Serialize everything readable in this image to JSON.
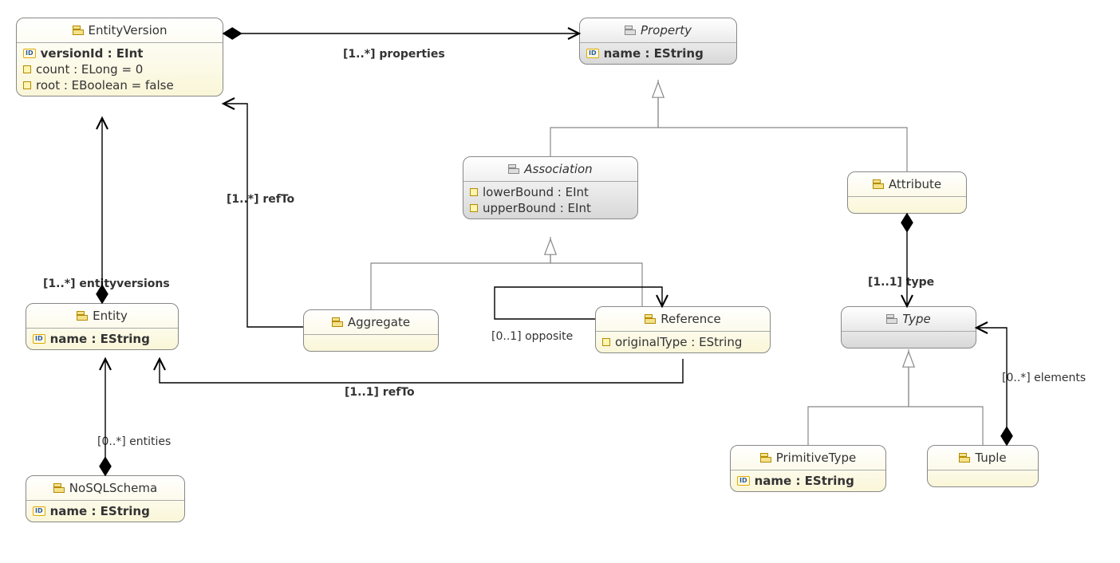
{
  "classes": {
    "EntityVersion": {
      "name": "EntityVersion",
      "attrs": {
        "versionId": "versionId : EInt",
        "count": "count : ELong = 0",
        "root": "root : EBoolean = false"
      }
    },
    "Property": {
      "name": "Property",
      "attrs": {
        "name": "name : EString"
      }
    },
    "Association": {
      "name": "Association",
      "attrs": {
        "lowerBound": "lowerBound : EInt",
        "upperBound": "upperBound : EInt"
      }
    },
    "Attribute": {
      "name": "Attribute",
      "attrs": {}
    },
    "Entity": {
      "name": "Entity",
      "attrs": {
        "name": "name : EString"
      }
    },
    "Aggregate": {
      "name": "Aggregate",
      "attrs": {}
    },
    "Reference": {
      "name": "Reference",
      "attrs": {
        "originalType": "originalType : EString"
      }
    },
    "Type": {
      "name": "Type",
      "attrs": {}
    },
    "PrimitiveType": {
      "name": "PrimitiveType",
      "attrs": {
        "name": "name : EString"
      }
    },
    "Tuple": {
      "name": "Tuple",
      "attrs": {}
    },
    "NoSQLSchema": {
      "name": "NoSQLSchema",
      "attrs": {
        "name": "name : EString"
      }
    }
  },
  "edges": {
    "properties": "[1..*] properties",
    "refToAgg": "[1..*] refTo",
    "entityversions": "[1..*] entityversions",
    "entities": "[0..*] entities",
    "opposite": "[0..1] opposite",
    "refToRef": "[1..1] refTo",
    "typeAttr": "[1..1] type",
    "elements": "[0..*] elements"
  },
  "chart_data": {
    "type": "uml-class-diagram",
    "classes": [
      {
        "name": "EntityVersion",
        "abstract": false,
        "attributes": [
          {
            "name": "versionId",
            "type": "EInt",
            "id": true
          },
          {
            "name": "count",
            "type": "ELong",
            "default": "0"
          },
          {
            "name": "root",
            "type": "EBoolean",
            "default": "false"
          }
        ]
      },
      {
        "name": "Property",
        "abstract": true,
        "attributes": [
          {
            "name": "name",
            "type": "EString",
            "id": true
          }
        ]
      },
      {
        "name": "Association",
        "abstract": true,
        "attributes": [
          {
            "name": "lowerBound",
            "type": "EInt"
          },
          {
            "name": "upperBound",
            "type": "EInt"
          }
        ]
      },
      {
        "name": "Attribute",
        "abstract": false,
        "attributes": []
      },
      {
        "name": "Entity",
        "abstract": false,
        "attributes": [
          {
            "name": "name",
            "type": "EString",
            "id": true
          }
        ]
      },
      {
        "name": "Aggregate",
        "abstract": false,
        "attributes": []
      },
      {
        "name": "Reference",
        "abstract": false,
        "attributes": [
          {
            "name": "originalType",
            "type": "EString"
          }
        ]
      },
      {
        "name": "Type",
        "abstract": true,
        "attributes": []
      },
      {
        "name": "PrimitiveType",
        "abstract": false,
        "attributes": [
          {
            "name": "name",
            "type": "EString",
            "id": true
          }
        ]
      },
      {
        "name": "Tuple",
        "abstract": false,
        "attributes": []
      },
      {
        "name": "NoSQLSchema",
        "abstract": false,
        "attributes": [
          {
            "name": "name",
            "type": "EString",
            "id": true
          }
        ]
      }
    ],
    "generalizations": [
      {
        "child": "Association",
        "parent": "Property"
      },
      {
        "child": "Attribute",
        "parent": "Property"
      },
      {
        "child": "Aggregate",
        "parent": "Association"
      },
      {
        "child": "Reference",
        "parent": "Association"
      },
      {
        "child": "PrimitiveType",
        "parent": "Type"
      },
      {
        "child": "Tuple",
        "parent": "Type"
      }
    ],
    "associations": [
      {
        "from": "EntityVersion",
        "to": "Property",
        "role": "properties",
        "multiplicity": "1..*",
        "kind": "composition"
      },
      {
        "from": "Entity",
        "to": "EntityVersion",
        "role": "entityversions",
        "multiplicity": "1..*",
        "kind": "composition"
      },
      {
        "from": "NoSQLSchema",
        "to": "Entity",
        "role": "entities",
        "multiplicity": "0..*",
        "kind": "composition"
      },
      {
        "from": "Attribute",
        "to": "Type",
        "role": "type",
        "multiplicity": "1..1",
        "kind": "composition"
      },
      {
        "from": "Tuple",
        "to": "Type",
        "role": "elements",
        "multiplicity": "0..*",
        "kind": "composition"
      },
      {
        "from": "Aggregate",
        "to": "EntityVersion",
        "role": "refTo",
        "multiplicity": "1..*",
        "kind": "reference"
      },
      {
        "from": "Reference",
        "to": "Entity",
        "role": "refTo",
        "multiplicity": "1..1",
        "kind": "reference"
      },
      {
        "from": "Reference",
        "to": "Reference",
        "role": "opposite",
        "multiplicity": "0..1",
        "kind": "reference"
      }
    ]
  }
}
